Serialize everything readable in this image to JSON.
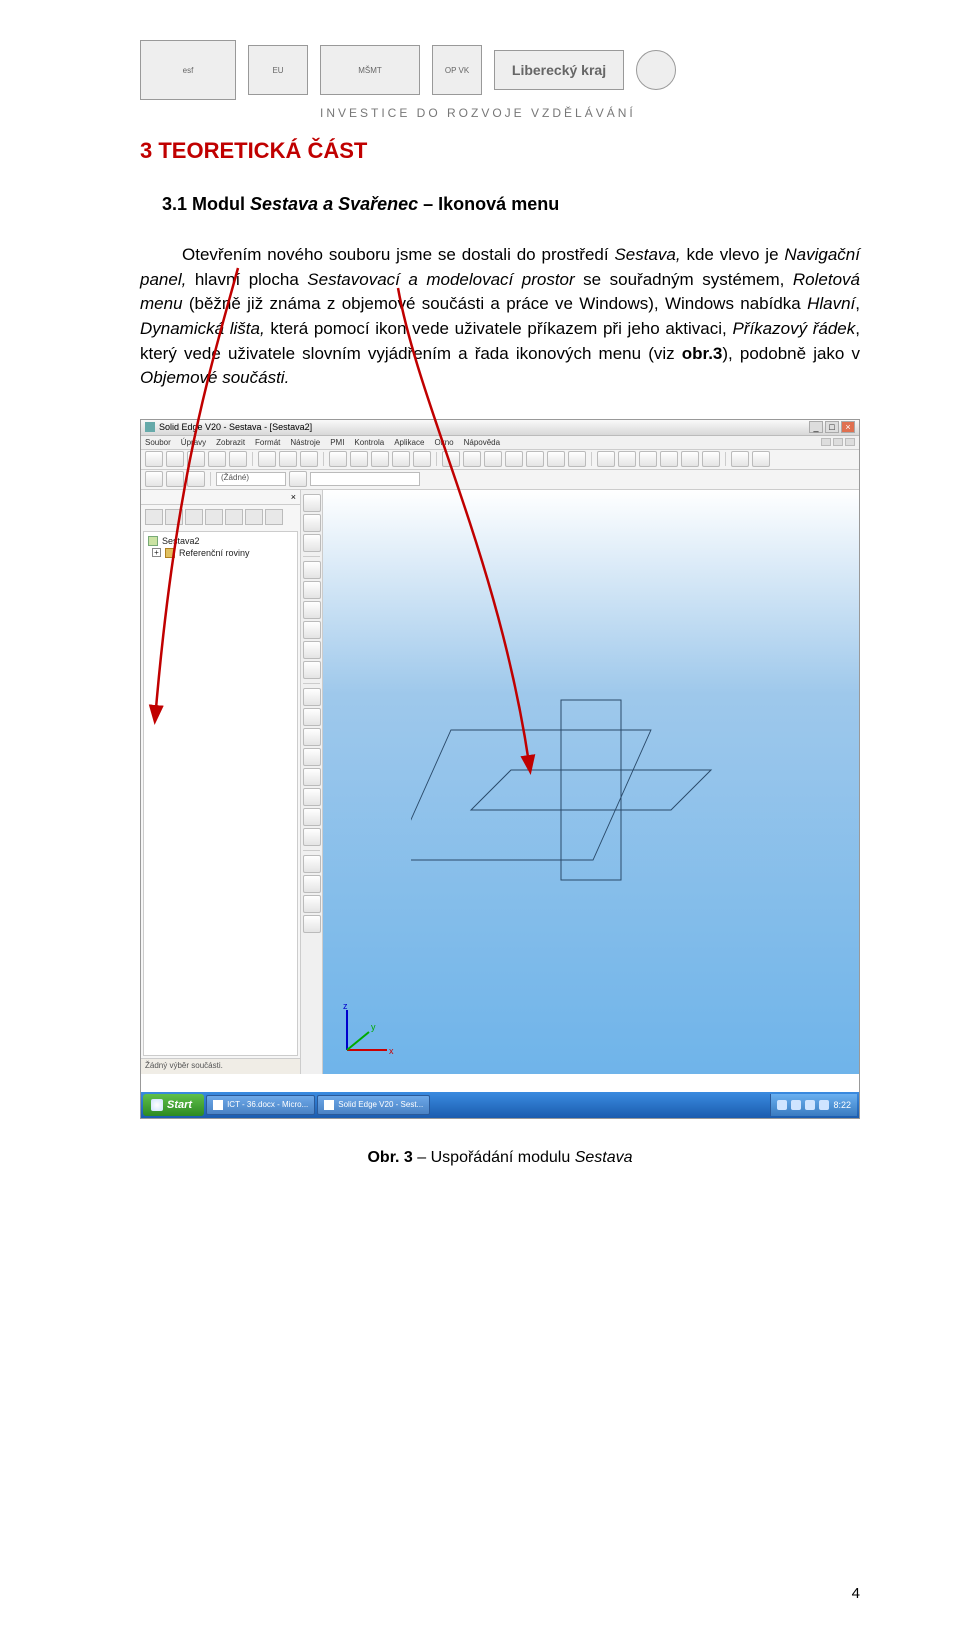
{
  "header": {
    "subhead": "INVESTICE DO ROZVOJE VZDĚLÁVÁNÍ",
    "logos": {
      "esf": "esf",
      "eu": "EU",
      "min": "MŠMT",
      "op": "OP VK",
      "kraj": "Liberecký kraj",
      "circle": ""
    }
  },
  "section": {
    "title": "3 TEORETICKÁ ČÁST",
    "subtitle_prefix": "3.1 Modul ",
    "subtitle_italic": "Sestava a Svařenec",
    "subtitle_suffix": " – Ikonová menu"
  },
  "paragraph": {
    "t1": "Otevřením nového souboru jsme se dostali do prostředí ",
    "i1": "Sestava, ",
    "t2": "kde vlevo je ",
    "i2": "Navigační panel, ",
    "t3": "hlavní plocha ",
    "i3": "Sestavovací a modelovací prostor ",
    "t4": "se souřadným systémem, ",
    "i4": "Roletová menu ",
    "t5": "(běžně již známa z objemové součásti a práce ve Windows), Windows nabídka ",
    "i5": "Hlavní",
    "t6": ", ",
    "i6": "Dynamická lišta, ",
    "t7": "která pomocí ikon vede uživatele příkazem při jeho aktivaci, ",
    "i7": "Příkazový řádek",
    "t8": ", který vede uživatele slovním vyjádřením a řada ikonových menu (viz ",
    "b1": "obr.3",
    "t9": "), podobně jako v ",
    "i8": "Objemové součásti.",
    "t10": ""
  },
  "screenshot": {
    "title": "Solid Edge V20 - Sestava - [Sestava2]",
    "menus": [
      "Soubor",
      "Úpravy",
      "Zobrazit",
      "Formát",
      "Nástroje",
      "PMI",
      "Kontrola",
      "Aplikace",
      "Okno",
      "Nápověda"
    ],
    "combo": "(Žádné)",
    "nav": {
      "header_close": "×",
      "root": "Sestava2",
      "child": "Referenční roviny",
      "status": "Žádný výběr součásti."
    },
    "axis": {
      "x": "x",
      "y": "y",
      "z": "z"
    },
    "taskbar": {
      "start": "Start",
      "tasks": [
        "ICT - 36.docx - Micro...",
        "Solid Edge V20 - Sest..."
      ],
      "time": "8:22"
    }
  },
  "caption": {
    "prefix": "Obr. 3",
    "mid": " – Uspořádání modulu ",
    "italic": "Sestava"
  },
  "page_number": "4"
}
